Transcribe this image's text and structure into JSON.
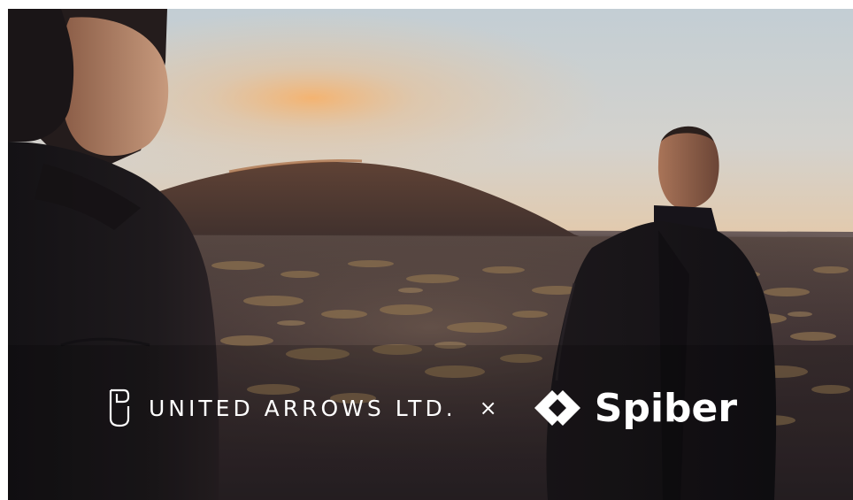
{
  "image": {
    "subject": "two-models-in-dark-outerwear-volcanic-landscape-dusk",
    "colors": {
      "sky_top": "#c6d0d6",
      "sky_horizon": "#e9c9a3",
      "glow": "#f3b877",
      "hill": "#4e3a34",
      "ground": "#3b2c2d",
      "shrub": "#8a6f4e",
      "coat": "#191618"
    }
  },
  "collab": {
    "brand_left": "UNITED ARROWS LTD.",
    "separator": "×",
    "brand_right": "Spiber",
    "icon_left": "united-arrows-icon",
    "icon_right": "spiber-icon",
    "text_color": "#ffffff"
  }
}
